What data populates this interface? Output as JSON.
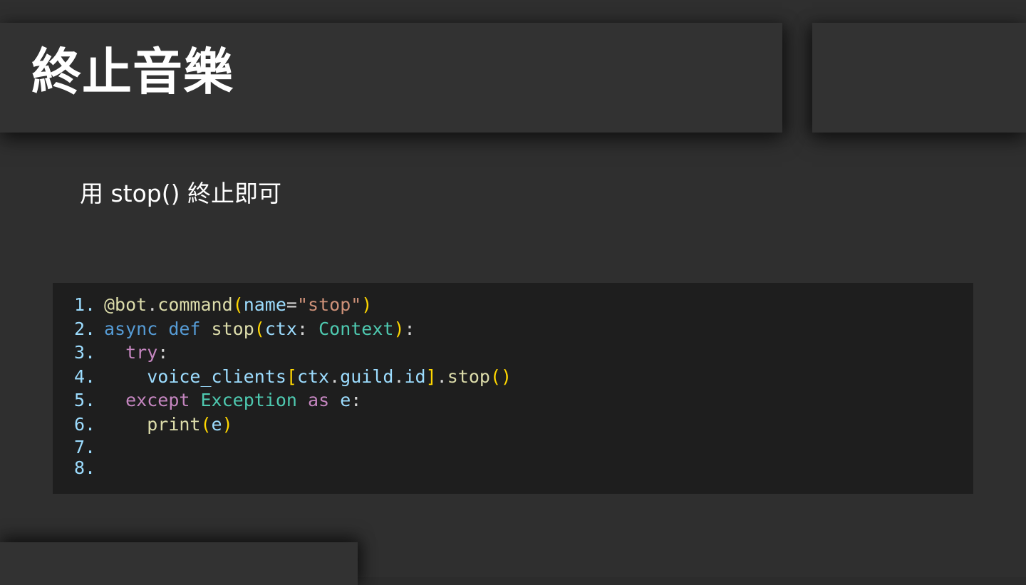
{
  "slide": {
    "title": "終止音樂",
    "subtitle": "用 stop() 終止即可"
  },
  "code": {
    "language": "python",
    "line_numbers": [
      "1.",
      "2.",
      "3.",
      "4.",
      "5.",
      "6.",
      "7.",
      "8."
    ],
    "lines": [
      [
        {
          "text": "@bot",
          "kind": "decorator"
        },
        {
          "text": ".",
          "kind": "punct"
        },
        {
          "text": "command",
          "kind": "function"
        },
        {
          "text": "(",
          "kind": "bracket"
        },
        {
          "text": "name",
          "kind": "variable"
        },
        {
          "text": "=",
          "kind": "punct"
        },
        {
          "text": "\"stop\"",
          "kind": "string"
        },
        {
          "text": ")",
          "kind": "bracket"
        }
      ],
      [
        {
          "text": "async",
          "kind": "keyword"
        },
        {
          "text": " ",
          "kind": "punct"
        },
        {
          "text": "def",
          "kind": "keyword"
        },
        {
          "text": " ",
          "kind": "punct"
        },
        {
          "text": "stop",
          "kind": "function"
        },
        {
          "text": "(",
          "kind": "bracket"
        },
        {
          "text": "ctx",
          "kind": "variable"
        },
        {
          "text": ": ",
          "kind": "punct"
        },
        {
          "text": "Context",
          "kind": "class"
        },
        {
          "text": ")",
          "kind": "bracket"
        },
        {
          "text": ":",
          "kind": "punct"
        }
      ],
      [
        {
          "text": "  ",
          "kind": "punct"
        },
        {
          "text": "try",
          "kind": "control"
        },
        {
          "text": ":",
          "kind": "punct"
        }
      ],
      [
        {
          "text": "    ",
          "kind": "punct"
        },
        {
          "text": "voice_clients",
          "kind": "variable"
        },
        {
          "text": "[",
          "kind": "bracket"
        },
        {
          "text": "ctx",
          "kind": "variable"
        },
        {
          "text": ".",
          "kind": "punct"
        },
        {
          "text": "guild",
          "kind": "variable"
        },
        {
          "text": ".",
          "kind": "punct"
        },
        {
          "text": "id",
          "kind": "variable"
        },
        {
          "text": "]",
          "kind": "bracket"
        },
        {
          "text": ".",
          "kind": "punct"
        },
        {
          "text": "stop",
          "kind": "function"
        },
        {
          "text": "()",
          "kind": "bracket"
        }
      ],
      [
        {
          "text": "  ",
          "kind": "punct"
        },
        {
          "text": "except",
          "kind": "control"
        },
        {
          "text": " ",
          "kind": "punct"
        },
        {
          "text": "Exception",
          "kind": "class"
        },
        {
          "text": " ",
          "kind": "punct"
        },
        {
          "text": "as",
          "kind": "control"
        },
        {
          "text": " ",
          "kind": "punct"
        },
        {
          "text": "e",
          "kind": "variable"
        },
        {
          "text": ":",
          "kind": "punct"
        }
      ],
      [
        {
          "text": "    ",
          "kind": "punct"
        },
        {
          "text": "print",
          "kind": "function"
        },
        {
          "text": "(",
          "kind": "bracket"
        },
        {
          "text": "e",
          "kind": "variable"
        },
        {
          "text": ")",
          "kind": "bracket"
        }
      ],
      [],
      []
    ]
  },
  "colors": {
    "background": "#2f2f2f",
    "panel": "#323232",
    "code_background": "#1e1e1e",
    "line_number": "#9cdcfe",
    "decorator": "#dcdcaa",
    "function": "#dcdcaa",
    "keyword": "#569cd6",
    "control": "#c586c0",
    "variable": "#9cdcfe",
    "class": "#4ec9b0",
    "string": "#ce9178",
    "punct": "#d4d4d4",
    "bracket": "#ffd700"
  }
}
